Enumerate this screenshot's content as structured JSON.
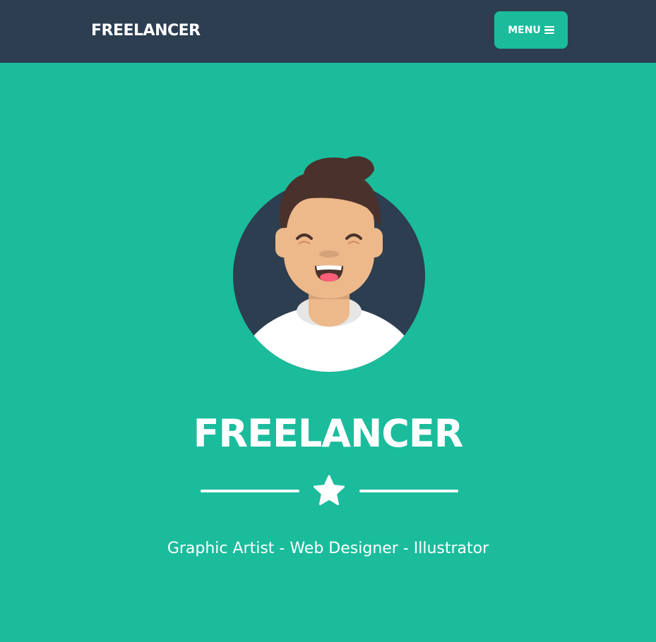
{
  "navbar": {
    "brand": "FREELANCER",
    "menu_label": "MENU",
    "menu_icon": "bars-icon"
  },
  "masthead": {
    "avatar_icon": "avatar-illustration",
    "heading": "FREELANCER",
    "divider_icon": "star-icon",
    "subheading": "Graphic Artist - Web Designer - Illustrator"
  },
  "colors": {
    "navbar_bg": "#2c3e50",
    "accent": "#1abc9c",
    "text": "#ffffff"
  }
}
